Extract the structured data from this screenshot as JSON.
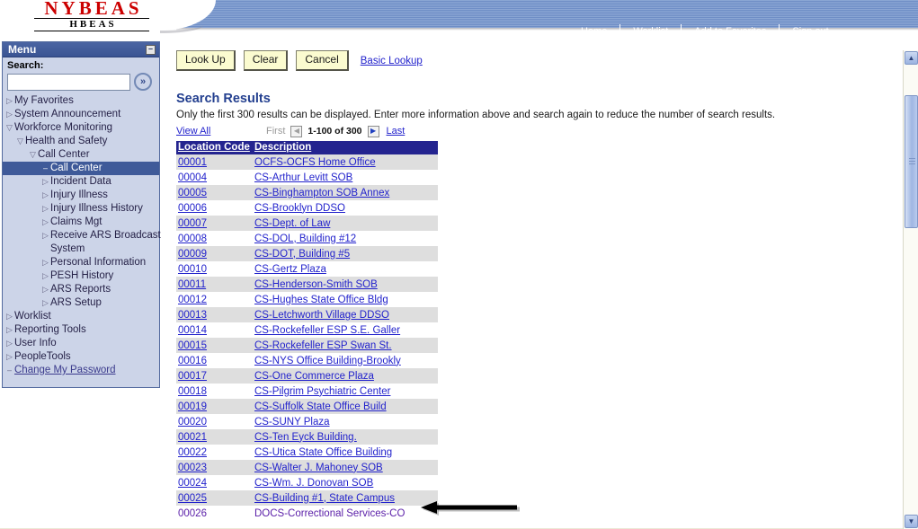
{
  "header": {
    "logo_main": "NYBEAS",
    "logo_sub": "HBEAS",
    "nav": [
      {
        "label": "Home",
        "name": "nav-home"
      },
      {
        "label": "Worklist",
        "name": "nav-worklist"
      },
      {
        "label": "Add to Favorites",
        "name": "nav-add-to-favorites"
      },
      {
        "label": "Sign out",
        "name": "nav-sign-out"
      }
    ]
  },
  "menu": {
    "title": "Menu",
    "minimize_glyph": "–",
    "search_label": "Search:",
    "search_value": "",
    "search_placeholder": "",
    "go_glyph": "»",
    "items": [
      {
        "label": "My Favorites",
        "level": 1,
        "marker": "▷",
        "state": "collapsed"
      },
      {
        "label": "System Announcement",
        "level": 1,
        "marker": "▷",
        "state": "collapsed"
      },
      {
        "label": "Workforce Monitoring",
        "level": 1,
        "marker": "▽",
        "state": "expanded"
      },
      {
        "label": "Health and Safety",
        "level": 2,
        "marker": "▽",
        "state": "expanded"
      },
      {
        "label": "Call Center",
        "level": 3,
        "marker": "▽",
        "state": "expanded"
      },
      {
        "label": "Call Center",
        "level": 4,
        "marker": "–",
        "state": "selected"
      },
      {
        "label": "Incident Data",
        "level": 4,
        "marker": "▷",
        "state": "collapsed"
      },
      {
        "label": "Injury Illness",
        "level": 4,
        "marker": "▷",
        "state": "collapsed"
      },
      {
        "label": "Injury Illness History",
        "level": 4,
        "marker": "▷",
        "state": "collapsed"
      },
      {
        "label": "Claims Mgt",
        "level": 4,
        "marker": "▷",
        "state": "collapsed"
      },
      {
        "label": "Receive ARS Broadcast",
        "level": 4,
        "marker": "▷",
        "state": "collapsed"
      },
      {
        "label": "System",
        "level": 0,
        "marker": "",
        "state": "continuation"
      },
      {
        "label": "Personal Information",
        "level": 4,
        "marker": "▷",
        "state": "collapsed"
      },
      {
        "label": "PESH History",
        "level": 4,
        "marker": "▷",
        "state": "collapsed"
      },
      {
        "label": "ARS Reports",
        "level": 4,
        "marker": "▷",
        "state": "collapsed"
      },
      {
        "label": "ARS Setup",
        "level": 4,
        "marker": "▷",
        "state": "collapsed"
      },
      {
        "label": "Worklist",
        "level": 1,
        "marker": "▷",
        "state": "collapsed"
      },
      {
        "label": "Reporting Tools",
        "level": 1,
        "marker": "▷",
        "state": "collapsed"
      },
      {
        "label": "User Info",
        "level": 1,
        "marker": "▷",
        "state": "collapsed"
      },
      {
        "label": "PeopleTools",
        "level": 1,
        "marker": "▷",
        "state": "collapsed"
      },
      {
        "label": "Change My Password",
        "level": 1,
        "marker": "–",
        "state": "link"
      }
    ]
  },
  "toolbar": {
    "look_up_label": "Look Up",
    "clear_label": "Clear",
    "cancel_label": "Cancel",
    "basic_lookup_label": "Basic Lookup"
  },
  "results": {
    "title": "Search Results",
    "note": "Only the first 300 results can be displayed. Enter more information above and search again to reduce the number of search results.",
    "pager": {
      "view_all": "View All",
      "first": "First",
      "prev_glyph": "◀",
      "count": "1-100 of 300",
      "next_glyph": "▶",
      "last": "Last"
    },
    "columns": [
      "Location Code",
      "Description"
    ],
    "rows": [
      {
        "code": "00001",
        "desc": "OCFS-OCFS Home Office",
        "link": true
      },
      {
        "code": "00004",
        "desc": "CS-Arthur Levitt SOB",
        "link": true
      },
      {
        "code": "00005",
        "desc": "CS-Binghampton SOB Annex",
        "link": true
      },
      {
        "code": "00006",
        "desc": "CS-Brooklyn DDSO",
        "link": true
      },
      {
        "code": "00007",
        "desc": "CS-Dept. of Law",
        "link": true
      },
      {
        "code": "00008",
        "desc": "CS-DOL, Building #12",
        "link": true
      },
      {
        "code": "00009",
        "desc": "CS-DOT, Building #5",
        "link": true
      },
      {
        "code": "00010",
        "desc": "CS-Gertz Plaza",
        "link": true
      },
      {
        "code": "00011",
        "desc": "CS-Henderson-Smith SOB",
        "link": true
      },
      {
        "code": "00012",
        "desc": "CS-Hughes State Office Bldg",
        "link": true
      },
      {
        "code": "00013",
        "desc": "CS-Letchworth Village DDSO",
        "link": true
      },
      {
        "code": "00014",
        "desc": "CS-Rockefeller ESP S.E. Galler",
        "link": true
      },
      {
        "code": "00015",
        "desc": "CS-Rockefeller ESP Swan St.",
        "link": true
      },
      {
        "code": "00016",
        "desc": "CS-NYS Office Building-Brookly",
        "link": true
      },
      {
        "code": "00017",
        "desc": "CS-One Commerce Plaza",
        "link": true
      },
      {
        "code": "00018",
        "desc": "CS-Pilgrim Psychiatric Center",
        "link": true
      },
      {
        "code": "00019",
        "desc": "CS-Suffolk State Office Build",
        "link": true
      },
      {
        "code": "00020",
        "desc": "CS-SUNY Plaza",
        "link": true
      },
      {
        "code": "00021",
        "desc": "CS-Ten Eyck Building.",
        "link": true
      },
      {
        "code": "00022",
        "desc": "CS-Utica State Office Building",
        "link": true
      },
      {
        "code": "00023",
        "desc": "CS-Walter J. Mahoney SOB",
        "link": true
      },
      {
        "code": "00024",
        "desc": "CS-Wm. J. Donovan SOB",
        "link": true
      },
      {
        "code": "00025",
        "desc": "CS-Building #1, State Campus",
        "link": true
      },
      {
        "code": "00026",
        "desc": "DOCS-Correctional Services-CO",
        "link": false
      }
    ]
  },
  "annotation": {
    "arrow_target_row": "00025",
    "arrow_direction": "left"
  },
  "scrollbar": {
    "up_glyph": "▲",
    "down_glyph": "▼"
  },
  "colors": {
    "banner": "#7d99ce",
    "menu_header": "#3f5a99",
    "table_header": "#24248f",
    "row_alt": "#dedede",
    "link": "#2222cc",
    "button": "#fbfbd0",
    "logo_red": "#cc0000"
  }
}
